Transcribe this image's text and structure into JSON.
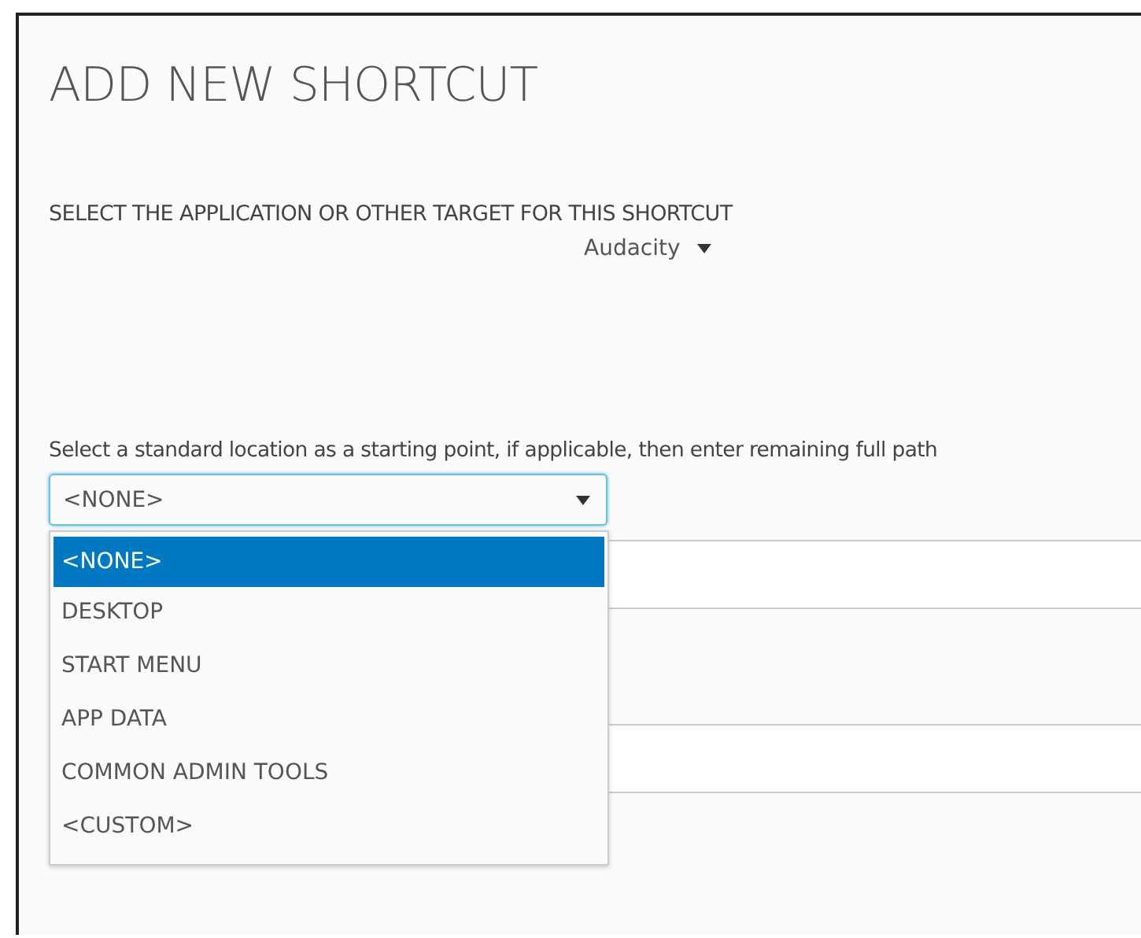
{
  "title": "ADD NEW SHORTCUT",
  "target": {
    "label": "SELECT THE APPLICATION OR OTHER TARGET FOR THIS SHORTCUT",
    "value": "Audacity"
  },
  "location": {
    "instruction": "Select a standard location as a starting point, if applicable, then enter remaining full path",
    "value": "<NONE>",
    "expanded": true,
    "options": [
      {
        "label": "<NONE>",
        "selected": true
      },
      {
        "label": "DESKTOP",
        "selected": false
      },
      {
        "label": "START MENU",
        "selected": false
      },
      {
        "label": "APP DATA",
        "selected": false
      },
      {
        "label": "COMMON ADMIN TOOLS",
        "selected": false
      },
      {
        "label": "<CUSTOM>",
        "selected": false
      }
    ]
  }
}
